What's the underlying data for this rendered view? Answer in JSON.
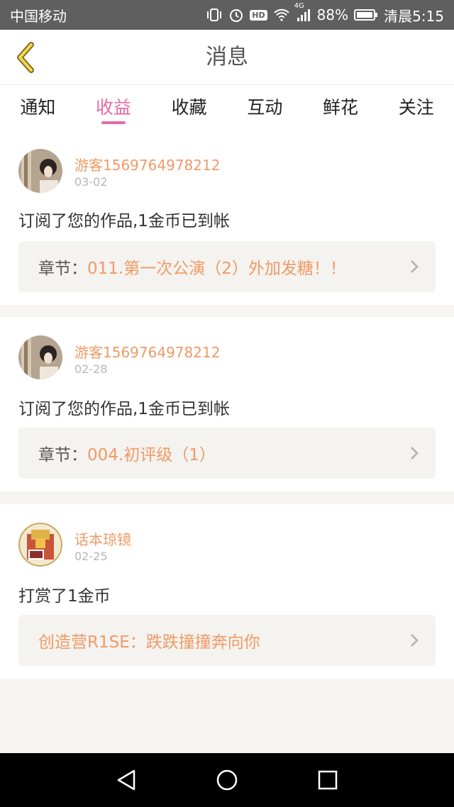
{
  "status_bar": {
    "carrier": "中国移动",
    "battery": "88%",
    "time": "清晨5:15",
    "hd_label": "HD",
    "net_label": "4G"
  },
  "header": {
    "title": "消息"
  },
  "tabs": [
    {
      "label": "通知",
      "active": false
    },
    {
      "label": "收益",
      "active": true
    },
    {
      "label": "收藏",
      "active": false
    },
    {
      "label": "互动",
      "active": false
    },
    {
      "label": "鲜花",
      "active": false
    },
    {
      "label": "关注",
      "active": false
    }
  ],
  "messages": [
    {
      "user": "游客1569764978212",
      "date": "03-02",
      "text": "订阅了您的作品,1金币已到帐",
      "chapter_label": "章节：",
      "chapter_title": "011.第一次公演（2）外加发糖！！"
    },
    {
      "user": "游客1569764978212",
      "date": "02-28",
      "text": "订阅了您的作品,1金币已到帐",
      "chapter_label": "章节：",
      "chapter_title": "004.初评级（1）"
    },
    {
      "user": "话本琼镜",
      "date": "02-25",
      "text": "打赏了1金币",
      "chapter_label": "",
      "chapter_title": "创造营R1SE：跌跌撞撞奔向你"
    }
  ],
  "colors": {
    "accent": "#e56aa6",
    "orange": "#f09a66",
    "status_bar": "#5f5f5f"
  },
  "icons": [
    "back-icon",
    "vibrate-icon",
    "alarm-icon",
    "hd-icon",
    "wifi-icon",
    "signal-icon",
    "battery-icon",
    "chevron-right-icon",
    "nav-back-icon",
    "nav-home-icon",
    "nav-recent-icon"
  ]
}
